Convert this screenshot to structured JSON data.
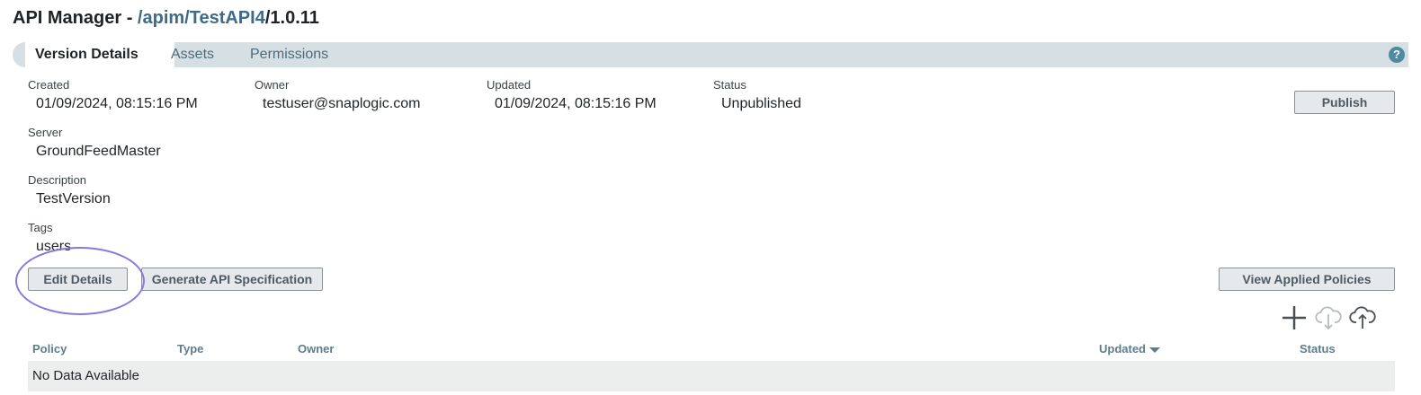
{
  "header": {
    "title_prefix": "API Manager - ",
    "path_link": "/apim/TestAPI4",
    "path_suffix": "/1.0.11"
  },
  "tabs": [
    {
      "label": "Version Details",
      "active": true
    },
    {
      "label": "Assets",
      "active": false
    },
    {
      "label": "Permissions",
      "active": false
    }
  ],
  "help_icon": {
    "glyph": "?",
    "icon": "help-icon"
  },
  "details": {
    "created": {
      "label": "Created",
      "value": "01/09/2024, 08:15:16 PM"
    },
    "owner": {
      "label": "Owner",
      "value": "testuser@snaplogic.com"
    },
    "updated": {
      "label": "Updated",
      "value": "01/09/2024, 08:15:16 PM"
    },
    "status": {
      "label": "Status",
      "value": "Unpublished"
    },
    "server": {
      "label": "Server",
      "value": "GroundFeedMaster"
    },
    "description": {
      "label": "Description",
      "value": "TestVersion"
    },
    "tags": {
      "label": "Tags",
      "value": "users"
    }
  },
  "buttons": {
    "publish": "Publish",
    "edit_details": "Edit Details",
    "generate_spec": "Generate API Specification",
    "view_policies": "View Applied Policies"
  },
  "policy_actions": {
    "icons": [
      "plus-icon",
      "cloud-download-icon",
      "cloud-upload-icon"
    ]
  },
  "policies_table": {
    "columns": [
      "Policy",
      "Type",
      "Owner",
      "Updated",
      "Status"
    ],
    "sorted_column": "Updated",
    "empty_message": "No Data Available"
  },
  "colors": {
    "accent_link": "#3e6b8a",
    "tab_bar": "#d6dfe3",
    "annotation": "#8c77e0"
  }
}
